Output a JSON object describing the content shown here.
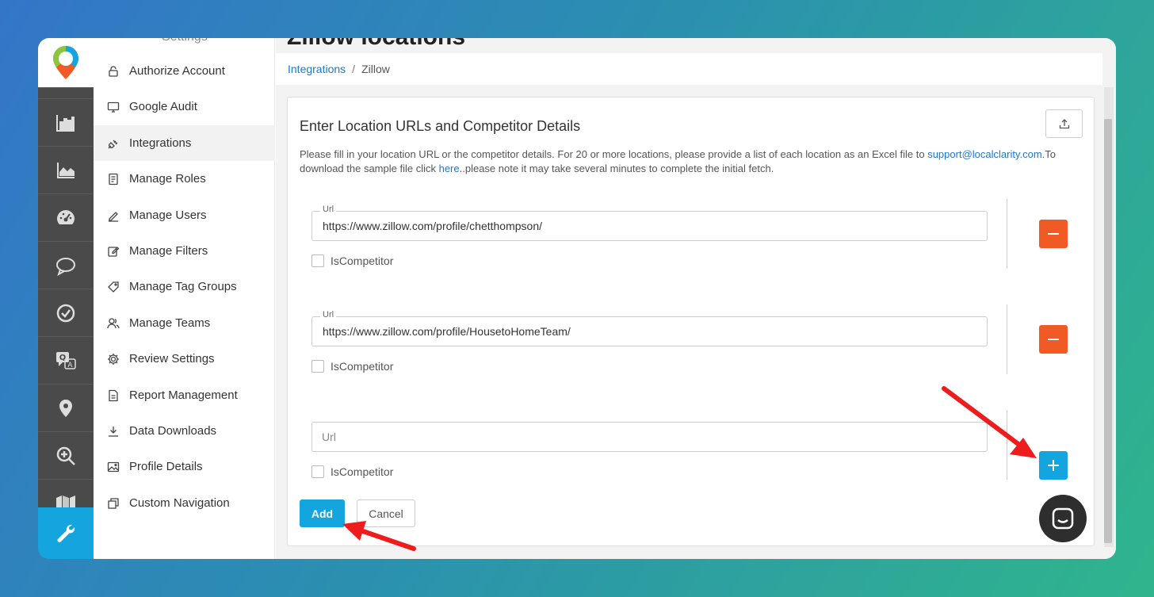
{
  "colors": {
    "accent": "#14a5df",
    "danger": "#f05a24",
    "rail": "#4a4a4a",
    "link": "#1e78c8",
    "annotation": "#ee1c1c"
  },
  "header": {
    "page_title": "Zillow locations",
    "menu_top_text": "Settings"
  },
  "rail": {
    "logo": "location-pin-logo",
    "items": [
      "bar-chart-icon",
      "area-chart-icon",
      "dashboard-gauge-icon",
      "chat-bubble-icon",
      "check-circle-icon",
      "translate-review-icon",
      "map-pin-icon",
      "zoom-in-icon",
      "map-icon",
      "wrench-icon"
    ]
  },
  "menu": {
    "items": [
      {
        "label": "Authorize Account",
        "icon": "lock-icon"
      },
      {
        "label": "Google Audit",
        "icon": "monitor-icon"
      },
      {
        "label": "Integrations",
        "icon": "plug-icon",
        "active": true
      },
      {
        "label": "Manage Roles",
        "icon": "document-icon"
      },
      {
        "label": "Manage Users",
        "icon": "pencil-icon"
      },
      {
        "label": "Manage Filters",
        "icon": "edit-box-icon"
      },
      {
        "label": "Manage Tag Groups",
        "icon": "tag-icon"
      },
      {
        "label": "Manage Teams",
        "icon": "users-icon"
      },
      {
        "label": "Review Settings",
        "icon": "gear-icon"
      },
      {
        "label": "Report Management",
        "icon": "file-icon"
      },
      {
        "label": "Data Downloads",
        "icon": "download-icon"
      },
      {
        "label": "Profile Details",
        "icon": "image-icon"
      },
      {
        "label": "Custom Navigation",
        "icon": "windows-icon"
      }
    ]
  },
  "breadcrumb": {
    "parent": "Integrations",
    "separator": "/",
    "current": "Zillow"
  },
  "card": {
    "title": "Enter Location URLs and Competitor Details",
    "upload_icon": "upload-icon",
    "desc_1": "Please fill in your location URL or the competitor details. For 20 or more locations, please provide a list of each location as an Excel file to ",
    "desc_email": "support@localclarity.com",
    "desc_2": ".To download the sample file click ",
    "desc_here": "here",
    "desc_3": "..please note it may take several minutes to complete the initial fetch.",
    "rows": [
      {
        "label": "Url",
        "value": "https://www.zillow.com/profile/chetthompson/",
        "checkbox_label": "IsCompetitor"
      },
      {
        "label": "Url",
        "value": "https://www.zillow.com/profile/HousetoHomeTeam/",
        "checkbox_label": "IsCompetitor"
      },
      {
        "placeholder": "Url",
        "checkbox_label": "IsCompetitor"
      }
    ],
    "add_label": "Add",
    "cancel_label": "Cancel"
  },
  "chat_icon": "chat-widget-icon"
}
